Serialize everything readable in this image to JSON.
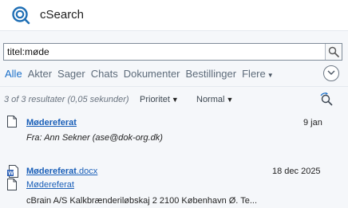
{
  "app": {
    "title": "cSearch"
  },
  "search": {
    "value": "titel:møde"
  },
  "tabs": [
    {
      "label": "Alle",
      "active": true
    },
    {
      "label": "Akter"
    },
    {
      "label": "Sager"
    },
    {
      "label": "Chats"
    },
    {
      "label": "Dokumenter"
    },
    {
      "label": "Bestillinger"
    },
    {
      "label": "Flere"
    }
  ],
  "results_bar": {
    "count_text": "3 of 3 resultater (0,05 sekunder)",
    "sort_field": "Prioritet",
    "sort_mode": "Normal"
  },
  "results": [
    {
      "title": "Mødereferat",
      "date": "9 jan",
      "from": "Fra: Ann Sekner (ase@dok-org.dk)",
      "icon": "document-icon"
    },
    {
      "title": "Mødereferat",
      "ext": ".docx",
      "date": "18 dec 2025",
      "sublink": "Mødereferat",
      "address": "cBrain A/S Kalkbrænderiløbskaj 2 2100 København Ø. Te...",
      "icon": "word-document-icon"
    }
  ],
  "colors": {
    "accent": "#1a6fc9",
    "link": "#1a5fb8",
    "background": "#f5f7fa"
  }
}
